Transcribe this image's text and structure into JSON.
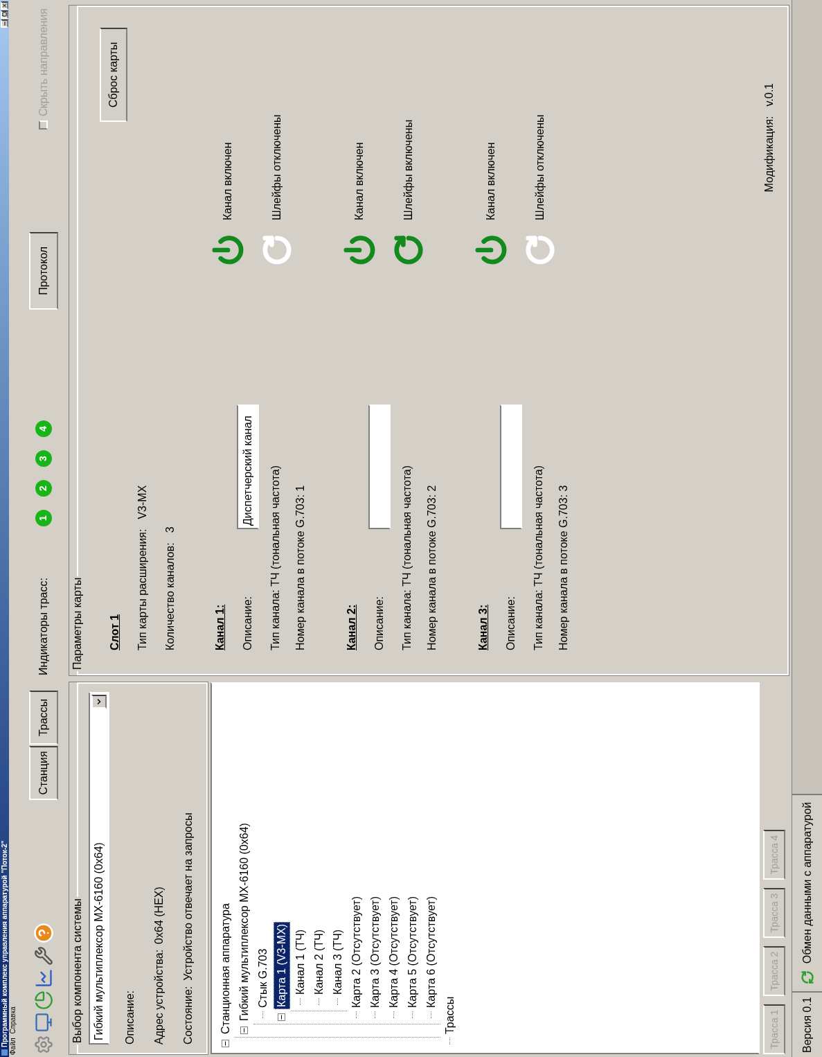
{
  "window": {
    "title": "Программный комплекс управления аппаратурой \"Поток-2\""
  },
  "menu": [
    "Файл",
    "Справка"
  ],
  "toolbar": {
    "buttons": [
      {
        "label": "Станция",
        "selected": false
      },
      {
        "label": "Трассы",
        "selected": false
      }
    ]
  },
  "track_indicators": {
    "label": "Индикаторы трасс:",
    "items": [
      {
        "label": "1",
        "on": true
      },
      {
        "label": "2",
        "on": true
      },
      {
        "label": "3",
        "on": true
      },
      {
        "label": "4",
        "on": true
      }
    ]
  },
  "protocol_button": "Протокол",
  "hide_directions": {
    "label": "Скрыть направления",
    "checked": false,
    "disabled": true
  },
  "component_selector": {
    "legend": "Выбор компонента системы",
    "value": "Гибкий мультиплексор МХ-6160 (0x64)",
    "fields": [
      {
        "label": "Описание:"
      },
      {
        "label": "Адрес устройства:",
        "value": "0x64 (HEX)"
      },
      {
        "label": "Состояние:",
        "value": "Устройство отвечает на запросы"
      }
    ]
  },
  "tree": [
    {
      "label": "Станционная аппаратура",
      "expanded": true,
      "selected": false,
      "children": [
        {
          "label": "Гибкий мультиплексор МХ-6160 (0x64)",
          "expanded": true,
          "selected": false,
          "children": [
            {
              "label": "Стык G.703",
              "selected": false
            },
            {
              "label": "Карта 1 (V3-MX)",
              "expanded": true,
              "selected": true,
              "children": [
                {
                  "label": "Канал 1 (ТЧ)",
                  "selected": false
                },
                {
                  "label": "Канал 2 (ТЧ)",
                  "selected": false
                },
                {
                  "label": "Канал 3 (ТЧ)",
                  "selected": false
                }
              ]
            },
            {
              "label": "Карта 2 (Отсутствует)",
              "selected": false
            },
            {
              "label": "Карта 3 (Отсутствует)",
              "selected": false
            },
            {
              "label": "Карта 4 (Отсутствует)",
              "selected": false
            },
            {
              "label": "Карта 5 (Отсутствует)",
              "selected": false
            },
            {
              "label": "Карта 6 (Отсутствует)",
              "selected": false
            }
          ]
        }
      ]
    },
    {
      "label": "Трассы",
      "selected": false
    }
  ],
  "track_buttons": [
    {
      "label": "Трасса 1",
      "disabled": true
    },
    {
      "label": "Трасса 2",
      "disabled": true
    },
    {
      "label": "Трасса 3",
      "disabled": true
    },
    {
      "label": "Трасса 4",
      "disabled": true
    }
  ],
  "card_params": {
    "legend": "Параметры карты",
    "slot": "Слот 1",
    "fields": [
      {
        "label": "Тип карты расширения:",
        "value": "V3-MX"
      },
      {
        "label": "Количество каналов:",
        "value": "3"
      }
    ],
    "reset_button": "Сброс карты",
    "channels": [
      {
        "title": "Канал 1:",
        "description_label": "Описание:",
        "description": "Диспетчерский канал",
        "type": "Тип канала: ТЧ (тональная частота)",
        "number": "Номер канала в потоке G.703: 1",
        "enabled": true,
        "enabled_label": "Канал включен",
        "loops": false,
        "loops_label": "Шлейфы отключены"
      },
      {
        "title": "Канал 2:",
        "description_label": "Описание:",
        "type": "Тип канала: ТЧ (тональная частота)",
        "number": "Номер канала в потоке G.703: 2",
        "enabled": true,
        "enabled_label": "Канал включен",
        "loops": true,
        "loops_label": "Шлейфы включены"
      },
      {
        "title": "Канал 3:",
        "description_label": "Описание:",
        "type": "Тип канала: ТЧ (тональная частота)",
        "number": "Номер канала в потоке G.703: 3",
        "enabled": true,
        "enabled_label": "Канал включен",
        "loops": false,
        "loops_label": "Шлейфы отключены"
      }
    ],
    "modification": {
      "label": "Модификация:",
      "value": "v.0.1"
    }
  },
  "status_bar": {
    "version": "Версия 0.1",
    "exchange": "Обмен данными с аппаратурой"
  }
}
